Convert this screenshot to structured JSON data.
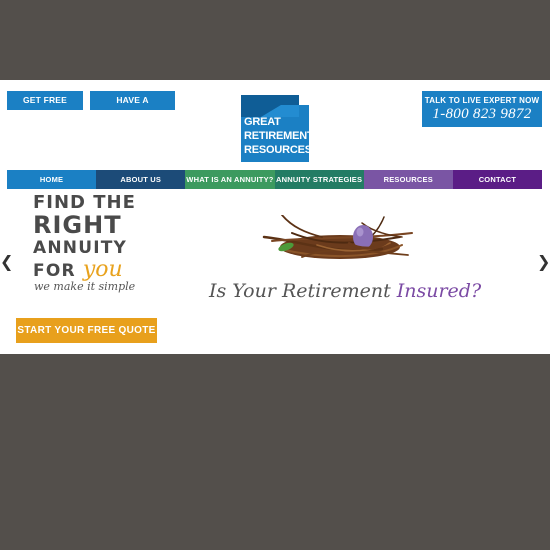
{
  "header": {
    "quote_button": "GET FREE QUOTE",
    "question_button": "HAVE A QUESTION?",
    "logo_lines": [
      "GREAT",
      "RETIREMENT",
      "RESOURCES"
    ],
    "expert_label": "TALK TO LIVE EXPERT NOW",
    "expert_phone": "1-800 823 9872"
  },
  "nav": {
    "items": [
      {
        "label": "HOME",
        "color": "#1b80c4"
      },
      {
        "label": "ABOUT US",
        "color": "#1c4b78"
      },
      {
        "label": "WHAT IS AN ANNUITY?",
        "color": "#3c9a5f"
      },
      {
        "label": "ANNUITY STRATEGIES",
        "color": "#237c64"
      },
      {
        "label": "RESOURCES",
        "color": "#7a55a4"
      },
      {
        "label": "CONTACT",
        "color": "#5b1d86"
      }
    ]
  },
  "hero": {
    "line1": "FIND THE",
    "line2": "RIGHT",
    "line3": "ANNUITY",
    "line4_prefix": "FOR ",
    "line4_accent": "you",
    "tagline": "we make it simple",
    "cta": "START YOUR FREE QUOTE",
    "slogan_prefix": "Is Your Retirement ",
    "slogan_accent": "Insured?",
    "nest_image": "bird-nest-with-purple-egg",
    "prev_arrow": "chevron-left-icon",
    "next_arrow": "chevron-right-icon"
  },
  "colors": {
    "brand_blue": "#1b80c4",
    "cta_orange": "#e8a01c",
    "accent_purple": "#7b4aa4",
    "backdrop": "#534f4b"
  }
}
